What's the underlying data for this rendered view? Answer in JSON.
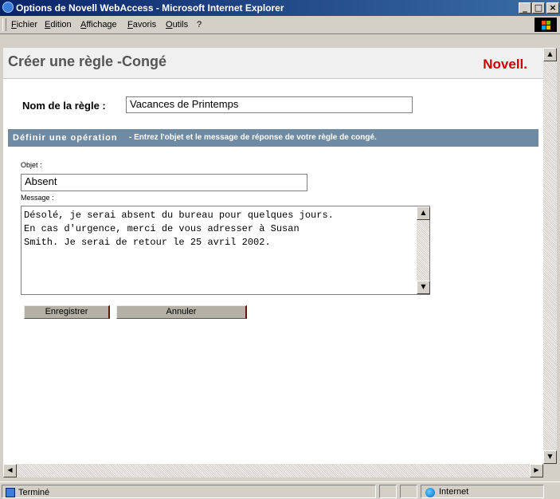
{
  "window": {
    "title": "Options de Novell WebAccess - Microsoft Internet Explorer",
    "minimize_label": "_",
    "maximize_label": "□",
    "close_label": "×"
  },
  "menu": [
    "Fichier",
    "Edition",
    "Affichage",
    "Favoris",
    "Outils",
    "?"
  ],
  "page": {
    "title": "Créer une règle -Congé",
    "brand": "Novell."
  },
  "form": {
    "rule_name_label": "Nom de la règle :",
    "rule_name_value": "Vacances de Printemps",
    "section_title": "Définir une opération",
    "section_desc": "- Entrez l'objet et le message de réponse de votre règle de congé.",
    "subject_label": "Objet :",
    "subject_value": "Absent",
    "message_label": "Message :",
    "message_value": "Désolé, je serai absent du bureau pour quelques jours.\nEn cas d'urgence, merci de vous adresser à Susan\nSmith. Je serai de retour le 25 avril 2002.",
    "save_label": "Enregistrer",
    "cancel_label": "Annuler"
  },
  "status": {
    "text": "Terminé",
    "zone": "Internet"
  },
  "colors": {
    "section_bar": "#6f8aa3",
    "brand": "#cc0000"
  }
}
